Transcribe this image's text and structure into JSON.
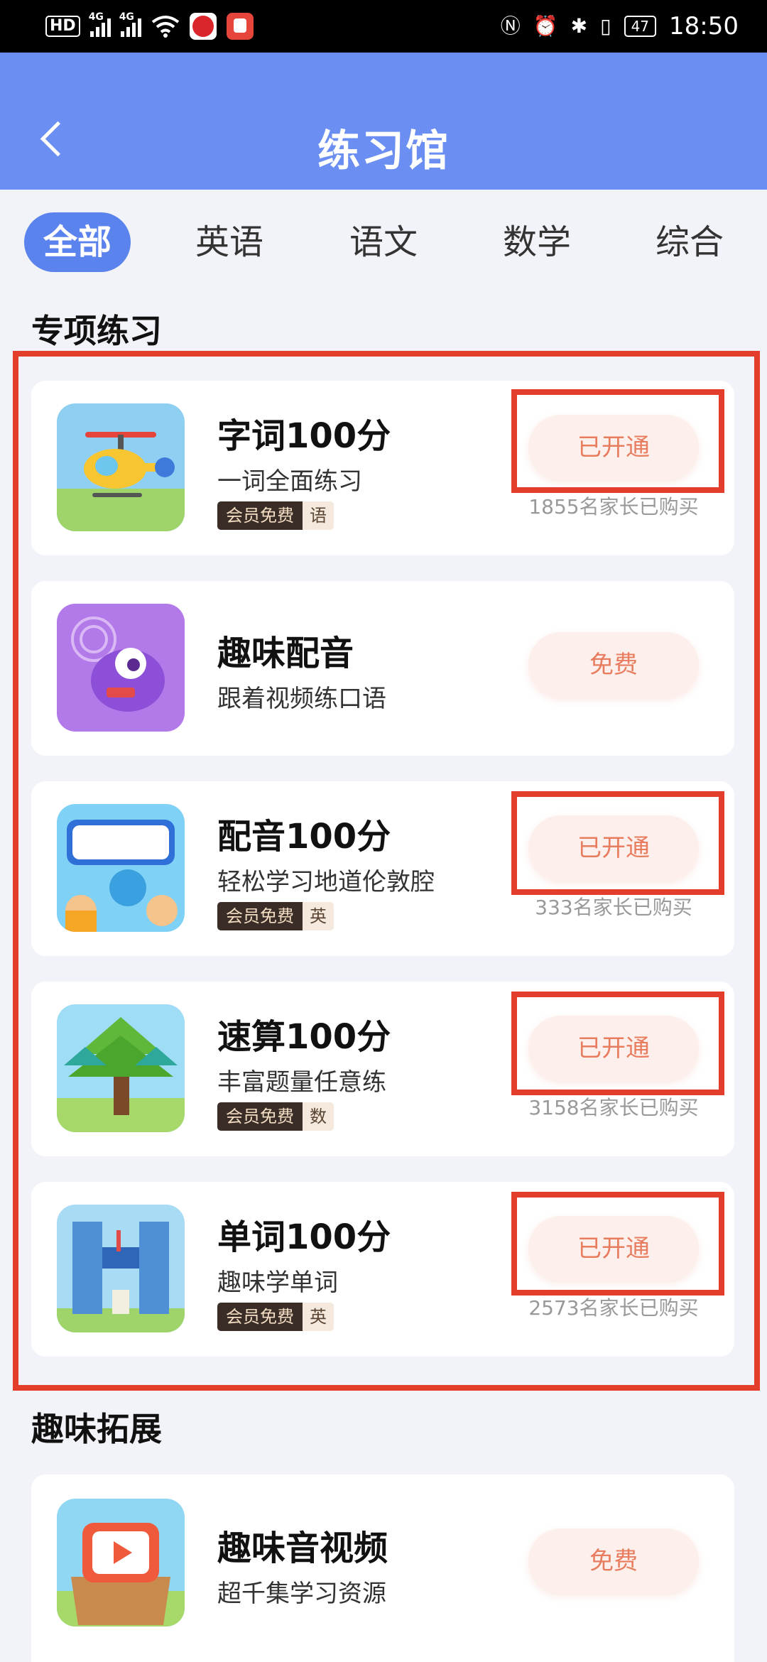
{
  "status_bar": {
    "hd": "HD",
    "net1": "4G",
    "net2": "4G",
    "battery": "47",
    "time": "18:50"
  },
  "header": {
    "title": "练习馆",
    "back_icon": "chevron-left-icon"
  },
  "tabs": [
    {
      "label": "全部",
      "active": true
    },
    {
      "label": "英语",
      "active": false
    },
    {
      "label": "语文",
      "active": false
    },
    {
      "label": "数学",
      "active": false
    },
    {
      "label": "综合",
      "active": false
    }
  ],
  "sections": [
    {
      "title": "专项练习",
      "cards": [
        {
          "title": "字词100分",
          "subtitle": "一词全面练习",
          "member_tag": "会员免费",
          "subject_tag": "语",
          "button": "已开通",
          "buyers": "1855名家长已购买",
          "icon": "helicopter-icon"
        },
        {
          "title": "趣味配音",
          "subtitle": "跟着视频练口语",
          "button": "免费",
          "icon": "purple-monster-icon"
        },
        {
          "title": "配音100分",
          "subtitle": "轻松学习地道伦敦腔",
          "member_tag": "会员免费",
          "subject_tag": "英",
          "button": "已开通",
          "buyers": "333名家长已购买",
          "icon": "dubbing-logo-icon"
        },
        {
          "title": "速算100分",
          "subtitle": "丰富题量任意练",
          "member_tag": "会员免费",
          "subject_tag": "数",
          "button": "已开通",
          "buyers": "3158名家长已购买",
          "icon": "tree-icon"
        },
        {
          "title": "单词100分",
          "subtitle": "趣味学单词",
          "member_tag": "会员免费",
          "subject_tag": "英",
          "button": "已开通",
          "buyers": "2573名家长已购买",
          "icon": "buildings-icon"
        }
      ]
    },
    {
      "title": "趣味拓展",
      "cards": [
        {
          "title": "趣味音视频",
          "subtitle": "超千集学习资源",
          "button": "免费",
          "icon": "video-box-icon"
        }
      ]
    }
  ],
  "colors": {
    "header_bg": "#6a8ef2",
    "tab_active": "#5b83ee",
    "button_text": "#e87c5e",
    "highlight": "#e33e2b"
  }
}
